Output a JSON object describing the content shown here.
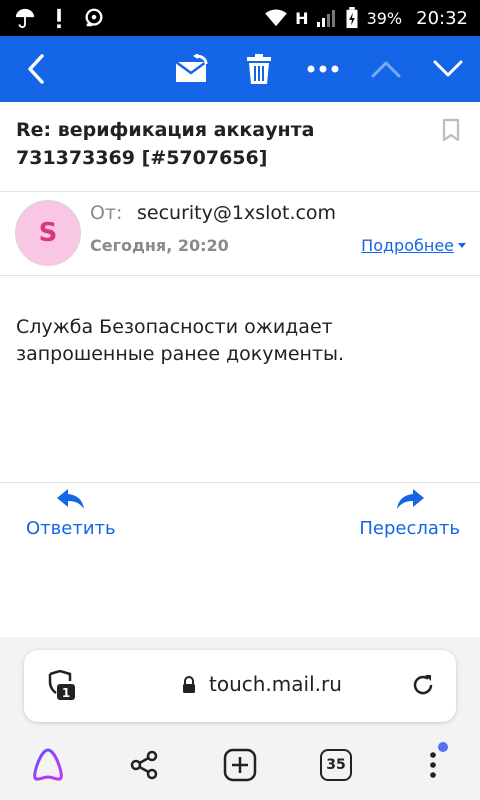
{
  "status_bar": {
    "network": "H",
    "battery": "39%",
    "time": "20:32"
  },
  "app_bar": {
    "icons": [
      "back-icon",
      "mark-unread-icon",
      "trash-icon",
      "more-icon",
      "previous-icon",
      "next-icon"
    ],
    "color": "#1565e8"
  },
  "email": {
    "subject": "Re: верификация аккаунта 731373369 [#5707656]",
    "avatar_letter": "S",
    "from_label": "От:",
    "from_address": "security@1xslot.com",
    "date": "Сегодня, 20:20",
    "details_link": "Подробнее",
    "body": "Служба Безопасности ожидает запрошенные ранее документы."
  },
  "actions": {
    "reply": "Ответить",
    "forward": "Переслать"
  },
  "browser": {
    "shield_count": "1",
    "url": "touch.mail.ru",
    "tabs_count": "35"
  }
}
